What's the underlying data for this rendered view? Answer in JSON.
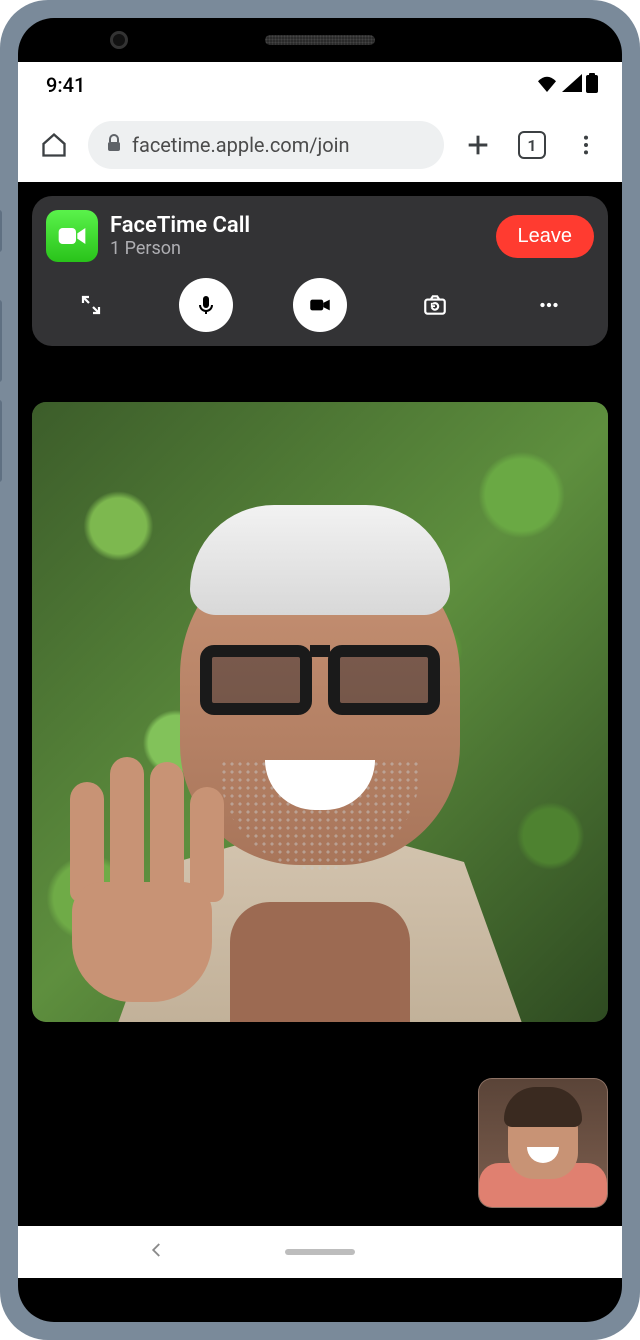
{
  "status": {
    "time": "9:41"
  },
  "browser": {
    "url_display": "facetime.apple.com/join",
    "tab_count": "1"
  },
  "call": {
    "title": "FaceTime Call",
    "subtitle": "1 Person",
    "leave_label": "Leave"
  }
}
